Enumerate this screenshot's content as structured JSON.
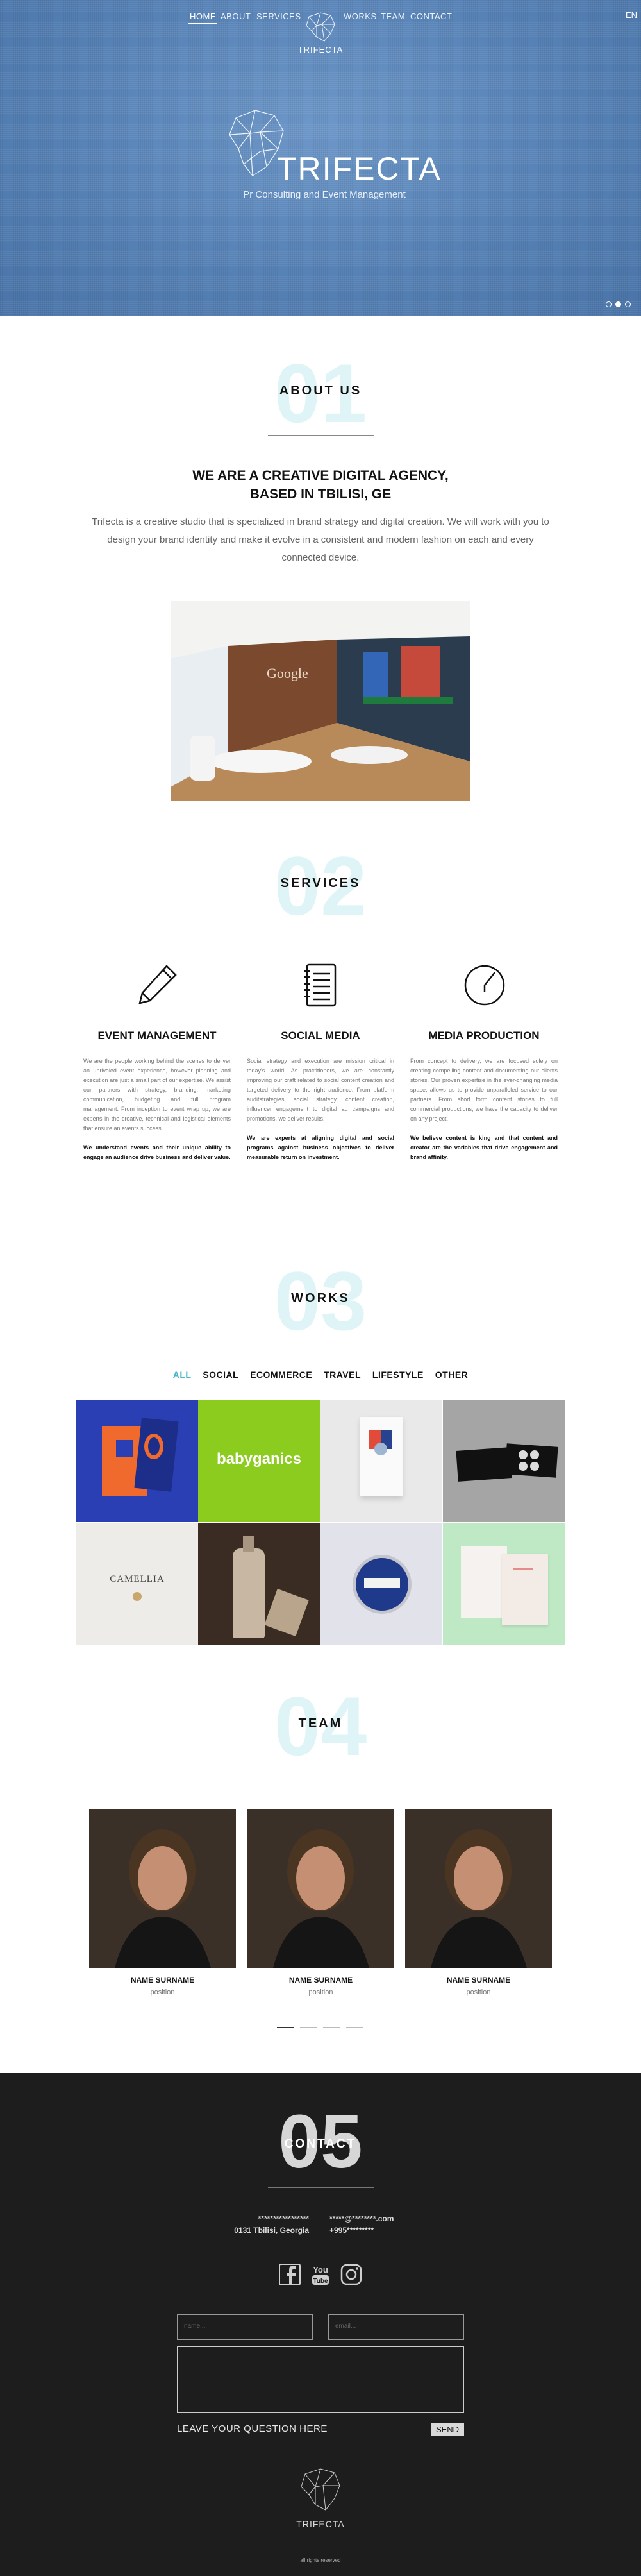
{
  "nav": {
    "items": [
      "HOME",
      "ABOUT",
      "SERVICES",
      "WORKS",
      "TEAM",
      "CONTACT"
    ],
    "logo_text": "TRIFECTA",
    "lang": "EN"
  },
  "hero": {
    "title": "TRIFECTA",
    "subtitle": "Pr Consulting and Event Management",
    "slides": 3,
    "active_slide": 2
  },
  "about": {
    "number": "01",
    "title": "ABOUT US",
    "heading_line1": "WE ARE A CREATIVE DIGITAL AGENCY,",
    "heading_line2": "BASED IN TBILISI, GE",
    "text": "Trifecta is a creative studio that is specialized in brand strategy and digital creation. We will work with you to design your brand identity and make it evolve in a consistent and modern fashion on each and every connected device.",
    "image_sign": "Google"
  },
  "services": {
    "number": "02",
    "title": "SERVICES",
    "items": [
      {
        "icon": "pencil-icon",
        "title": "EVENT MANAGEMENT",
        "text": "We are the people working behind the scenes to deliver an unrivaled event experience, however planning and execution are just a small part of our expertise. We assist our partners with strategy, branding, marketing communication, budgeting and full program management. From inception to event wrap up, we are experts in the creative, technical and logistical elements that ensure an events success.",
        "bold": "We understand events and their unique ability to engage an audience drive business and deliver value."
      },
      {
        "icon": "notebook-icon",
        "title": "SOCIAL MEDIA",
        "text": "Social strategy and execution are mission critical in today's world. As practitioners, we are constantly improving our craft related to social content creation and targeted delivery to the right audience. From platform auditstrategies, social strategy, content creation, influencer engagement to digital ad campaigns and promotions, we deliver results.",
        "bold": "We are experts at aligning digital and social programs against business objectives to deliver measurable return on investment."
      },
      {
        "icon": "clock-icon",
        "title": "MEDIA PRODUCTION",
        "text": "From concept to delivery, we are focused solely on creating compelling content and documenting our clients stories. Our proven expertise in the ever-changing media space, allows us to provide unparalleled service to our partners. From short form content stories to full commercial productions, we have the capacity to deliver on any project.",
        "bold": "We believe content is king and that content and creator are the variables that drive engagement and brand affinity."
      }
    ]
  },
  "works": {
    "number": "03",
    "title": "WORKS",
    "filters": [
      "ALL",
      "SOCIAL",
      "ECOMMERCE",
      "TRAVEL",
      "LIFESTYLE",
      "OTHER"
    ],
    "active_filter": "ALL",
    "tiles": [
      {
        "name": "blue-book-tile",
        "color": "#2a3fb4",
        "label": "NO"
      },
      {
        "name": "babyganics-tile",
        "color": "#8ccc1e",
        "label": "babyganics"
      },
      {
        "name": "packaging-tile",
        "color": "#e9e9e9",
        "label": ""
      },
      {
        "name": "business-cards-tile",
        "color": "#9c9c9c",
        "label": ""
      },
      {
        "name": "camellia-tile",
        "color": "#eeece8",
        "label": "CAMELLIA"
      },
      {
        "name": "bottle-tile",
        "color": "#3a2c22",
        "label": ""
      },
      {
        "name": "tin-tile",
        "color": "#e2e2ea",
        "label": ""
      },
      {
        "name": "stationery-tile",
        "color": "#bfe8c5",
        "label": ""
      }
    ]
  },
  "team": {
    "number": "04",
    "title": "TEAM",
    "members": [
      {
        "name": "NAME SURNAME",
        "position": "position"
      },
      {
        "name": "NAME SURNAME",
        "position": "position"
      },
      {
        "name": "NAME SURNAME",
        "position": "position"
      }
    ],
    "pages": 4,
    "active_page": 1
  },
  "contact": {
    "number": "05",
    "title": "CONTACT",
    "address_line1": "*****************",
    "address_line2": "0131 Tbilisi, Georgia",
    "email": "*****@********.com",
    "phone": "+995*********",
    "social": [
      "facebook-icon",
      "youtube-icon",
      "instagram-icon"
    ],
    "name_placeholder": "name...",
    "email_placeholder": "email...",
    "leave_label": "LEAVE YOUR QUESTION HERE",
    "send_label": "SEND",
    "footer_logo": "TRIFECTA",
    "copyright": "all rights reserved"
  }
}
